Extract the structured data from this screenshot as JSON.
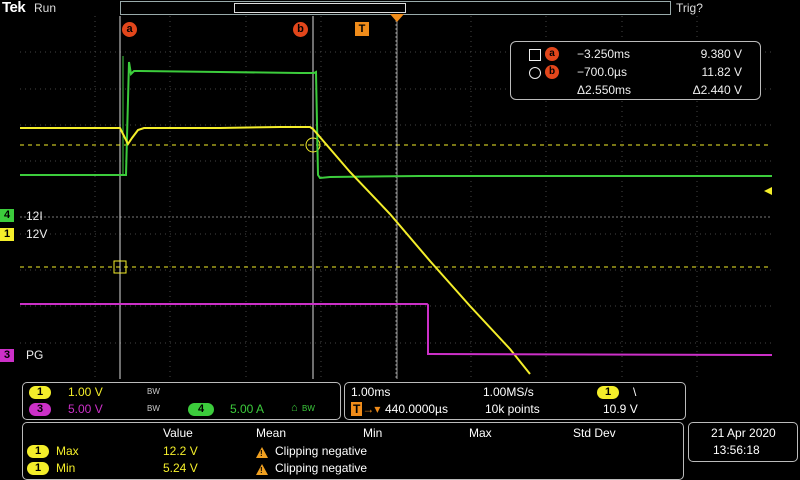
{
  "header": {
    "brand": "Tek",
    "run_state": "Run",
    "trigger_state": "Trig?"
  },
  "colors": {
    "ch1": "#f4ee2a",
    "ch3": "#cc30c8",
    "ch4": "#3ccc3c",
    "cursor": "#e2461b",
    "trigger": "#f08c1a"
  },
  "cursors": {
    "a_label": "a",
    "b_label": "b",
    "trigger_label": "T"
  },
  "readout": {
    "a_time": "−3.250ms",
    "a_value": "9.380 V",
    "b_time": "−700.0µs",
    "b_value": "11.82 V",
    "delta_time": "Δ2.550ms",
    "delta_value": "Δ2.440 V"
  },
  "channels": {
    "ch4_label": "12I",
    "ch1_label": "12V",
    "ch3_label": "PG",
    "ch4_num": "4",
    "ch1_num": "1",
    "ch3_num": "3"
  },
  "vertical": {
    "ch1_scale": "1.00 V",
    "ch3_scale": "5.00 V",
    "ch4_scale": "5.00 A",
    "bw_mark": "BW"
  },
  "horizontal": {
    "time_div": "1.00ms",
    "sample_rate": "1.00MS/s",
    "position": "440.0000µs",
    "record_length": "10k points",
    "trigger_level": "10.9 V",
    "trigger_slope": "\\"
  },
  "measurements": {
    "headers": [
      "Value",
      "Mean",
      "Min",
      "Max",
      "Std Dev"
    ],
    "rows": [
      {
        "ch": "1",
        "name": "Max",
        "value": "12.2 V",
        "mean": "Clipping negative"
      },
      {
        "ch": "1",
        "name": "Min",
        "value": "5.24 V",
        "mean": "Clipping negative"
      }
    ]
  },
  "datetime": {
    "date": "21 Apr  2020",
    "time": "13:56:18"
  }
}
